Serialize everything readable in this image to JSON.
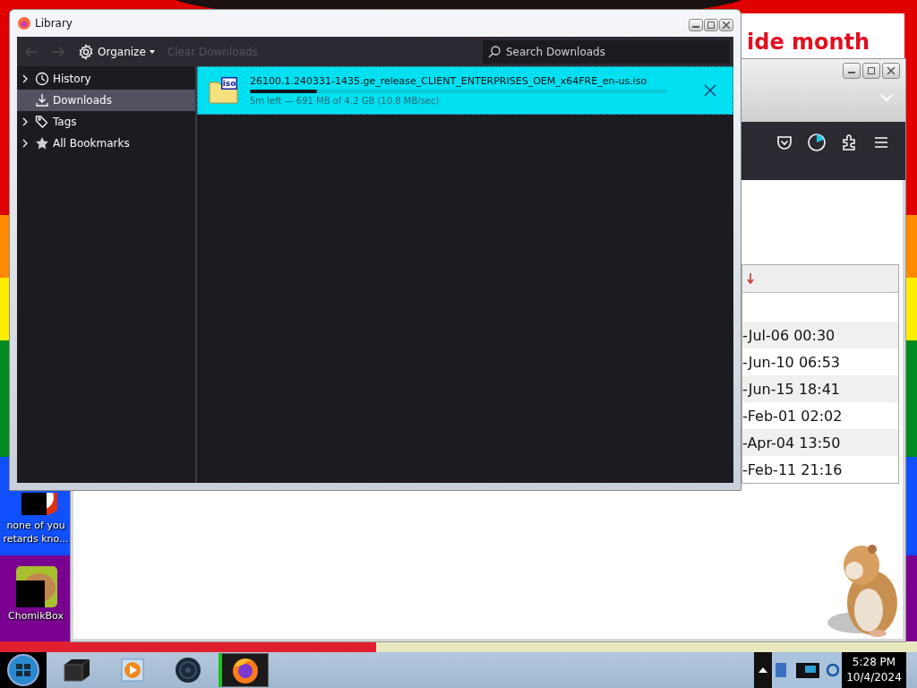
{
  "background_page": {
    "heading": "ide month"
  },
  "browser": {
    "table": {
      "rows": [
        "-Jul-06 00:30",
        "-Jun-10 06:53",
        "-Jun-15 18:41",
        "-Feb-01 02:02",
        "-Apr-04 13:50",
        "-Feb-11 21:16"
      ]
    }
  },
  "library": {
    "title": "Library",
    "toolbar": {
      "back": {
        "disabled": true
      },
      "forward": {
        "disabled": true
      },
      "organize": "Organize",
      "clear_downloads": {
        "label": "Clear Downloads",
        "disabled": true
      },
      "search": {
        "placeholder": "Search Downloads"
      }
    },
    "sidebar": {
      "items": [
        {
          "kind": "history",
          "label": "History",
          "expandable": true,
          "selected": false
        },
        {
          "kind": "downloads",
          "label": "Downloads",
          "expandable": false,
          "selected": true
        },
        {
          "kind": "tags",
          "label": "Tags",
          "expandable": true,
          "selected": false
        },
        {
          "kind": "bookmarks",
          "label": "All Bookmarks",
          "expandable": true,
          "selected": false
        }
      ]
    },
    "downloads": [
      {
        "filename": "26100.1.240331-1435.ge_release_CLIENT_ENTERPRISES_OEM_x64FRE_en-us.iso",
        "file_type": "iso",
        "status": "5m left — 691 MB of 4.2 GB (10.8 MB/sec)",
        "level": 0.16,
        "selected": true
      }
    ]
  },
  "desktop_icons": [
    {
      "label": "none of you retards kno..."
    },
    {
      "label": "ChomikBox"
    }
  ],
  "taskbar": {
    "apps": [
      {
        "kind": "box",
        "active": false
      },
      {
        "kind": "media",
        "active": false
      },
      {
        "kind": "globe",
        "active": false
      },
      {
        "kind": "firefox",
        "active": true
      }
    ],
    "clock": {
      "time": "5:28 PM",
      "date": "10/4/2024"
    }
  }
}
